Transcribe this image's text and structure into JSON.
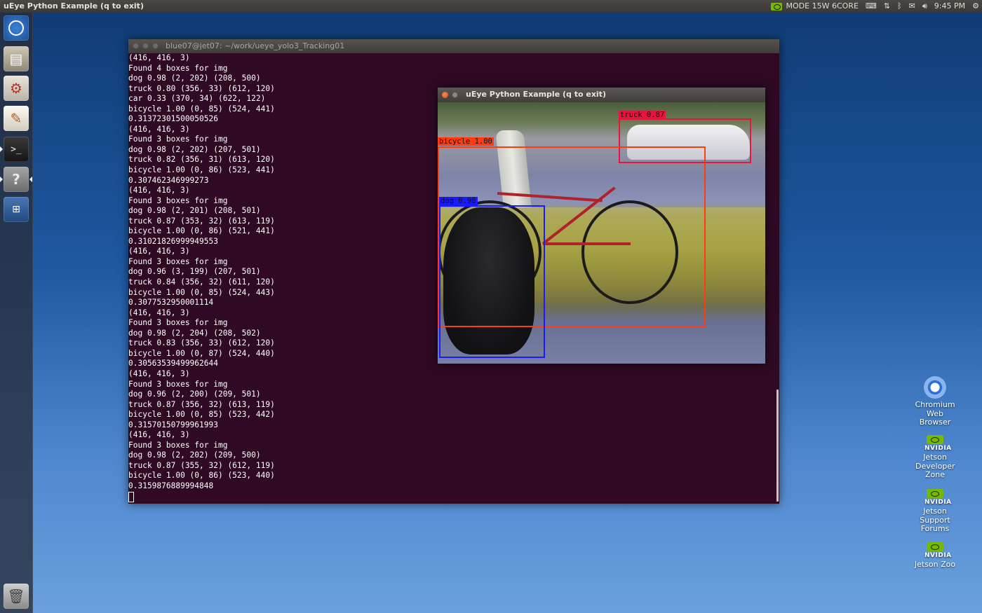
{
  "top_panel": {
    "app_title": "uEye Python Example (q to exit)",
    "nvidia_mode": "MODE 15W 6CORE",
    "time": "9:45 PM",
    "icons": [
      "nvidia-icon",
      "keyboard-icon",
      "network-icon",
      "bluetooth-icon",
      "mail-icon",
      "volume-icon",
      "gear-icon"
    ]
  },
  "launcher": {
    "items": [
      "dash-home",
      "files",
      "system-settings",
      "text-editor",
      "terminal",
      "help",
      "workspace-switcher",
      "trash"
    ]
  },
  "terminal": {
    "title": "blue07@jet07: ~/work/ueye_yolo3_Tracking01",
    "lines": [
      "(416, 416, 3)",
      "Found 4 boxes for img",
      "dog 0.98 (2, 202) (208, 500)",
      "truck 0.80 (356, 33) (612, 120)",
      "car 0.33 (370, 34) (622, 122)",
      "bicycle 1.00 (0, 85) (524, 441)",
      "0.31372301500050526",
      "(416, 416, 3)",
      "Found 3 boxes for img",
      "dog 0.98 (2, 202) (207, 501)",
      "truck 0.82 (356, 31) (613, 120)",
      "bicycle 1.00 (0, 86) (523, 441)",
      "0.307462346999273",
      "(416, 416, 3)",
      "Found 3 boxes for img",
      "dog 0.98 (2, 201) (208, 501)",
      "truck 0.87 (353, 32) (613, 119)",
      "bicycle 1.00 (0, 86) (521, 441)",
      "0.31021826999949553",
      "(416, 416, 3)",
      "Found 3 boxes for img",
      "dog 0.96 (3, 199) (207, 501)",
      "truck 0.84 (356, 32) (611, 120)",
      "bicycle 1.00 (0, 85) (524, 443)",
      "0.3077532950001114",
      "(416, 416, 3)",
      "Found 3 boxes for img",
      "dog 0.98 (2, 204) (208, 502)",
      "truck 0.83 (356, 33) (612, 120)",
      "bicycle 1.00 (0, 87) (524, 440)",
      "0.30563539499962644",
      "(416, 416, 3)",
      "Found 3 boxes for img",
      "dog 0.96 (2, 200) (209, 501)",
      "truck 0.87 (356, 32) (613, 119)",
      "bicycle 1.00 (0, 85) (523, 442)",
      "0.31570150799961993",
      "(416, 416, 3)",
      "Found 3 boxes for img",
      "dog 0.98 (2, 202) (209, 500)",
      "truck 0.87 (355, 32) (612, 119)",
      "bicycle 1.00 (0, 86) (523, 440)",
      "0.3159876889994848"
    ]
  },
  "ueye_window": {
    "title": "uEye Python Example (q to exit)",
    "detections": {
      "truck": {
        "label": "truck 0.87",
        "color": "#e8143c"
      },
      "bicycle": {
        "label": "bicycle 1.00",
        "color": "#ff3b10"
      },
      "dog": {
        "label": "dog 0.98",
        "color": "#1a1aff"
      }
    }
  },
  "desktop_icons": {
    "chromium": "Chromium Web Browser",
    "dev_zone": "Jetson Developer Zone",
    "forums": "Jetson Support Forums",
    "zoo": "Jetson Zoo",
    "nvidia_brand": "NVIDIA"
  },
  "colors": {
    "terminal_bg": "#300a24",
    "nvidia_green": "#76b900"
  }
}
